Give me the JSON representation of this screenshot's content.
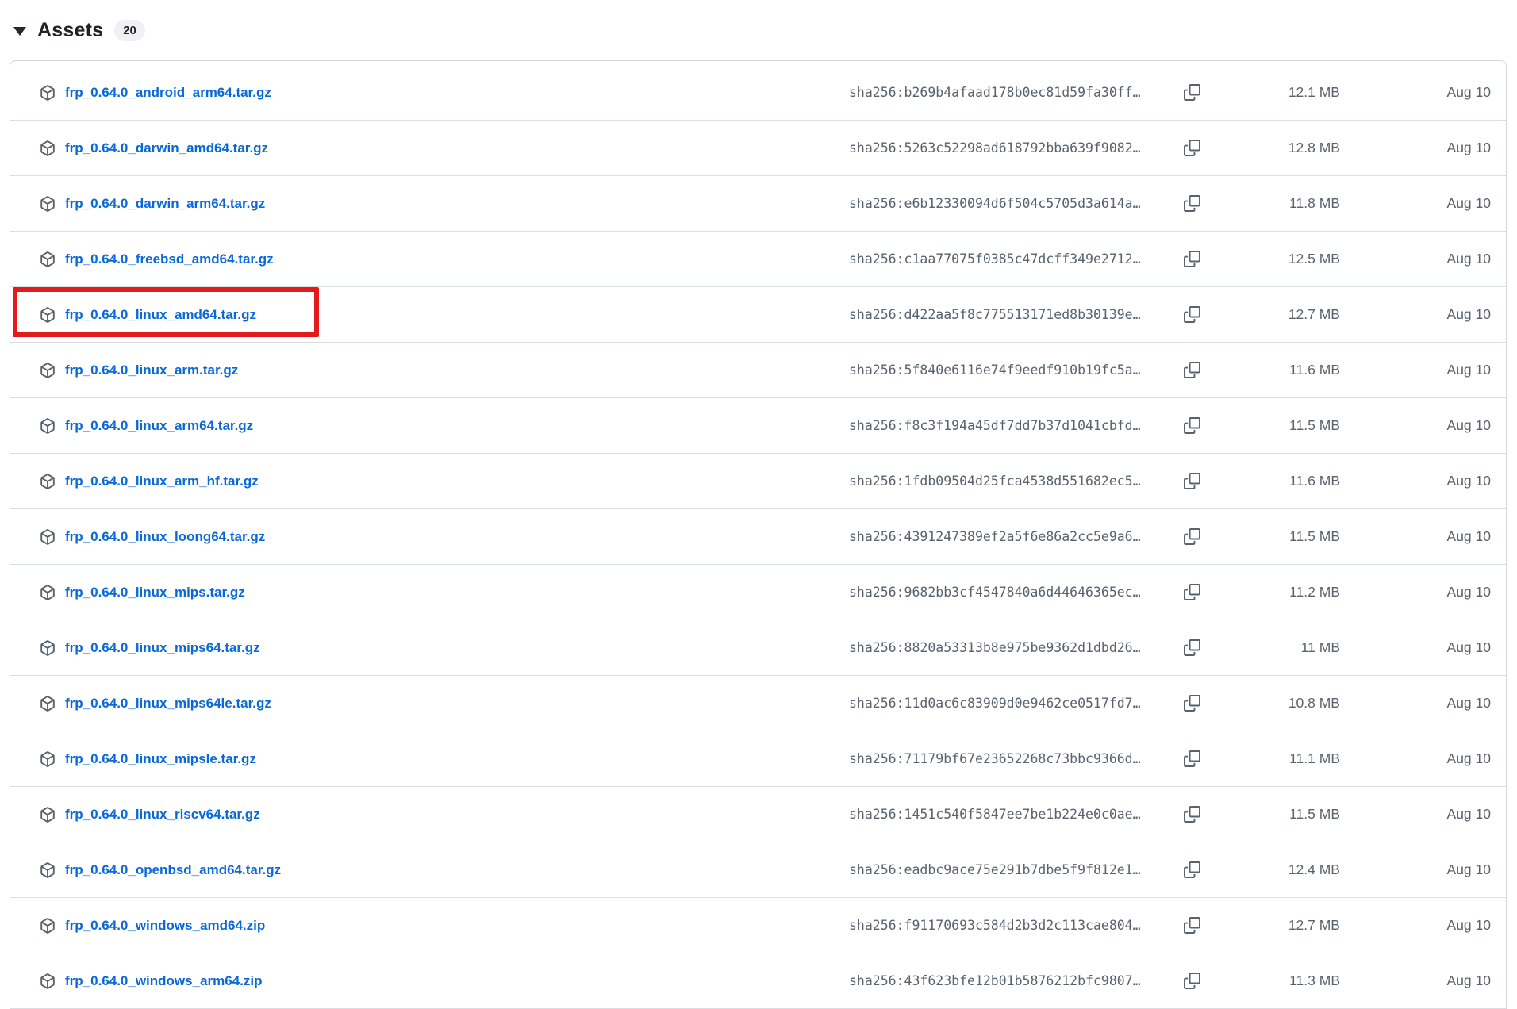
{
  "header": {
    "title": "Assets",
    "count": "20"
  },
  "colors": {
    "link_blue": "#0969da",
    "muted_gray": "#59636e",
    "row_border": "#d9dee3",
    "table_border": "#d0d7de",
    "badge_bg": "#eff1f4",
    "highlight_red": "#e31b1b"
  },
  "table": {
    "rows": [
      {
        "file": "frp_0.64.0_android_arm64.tar.gz",
        "hash": "sha256:b269b4afaad178b0ec81d59fa30ff…",
        "size": "12.1 MB",
        "date": "Aug 10",
        "highlighted": false
      },
      {
        "file": "frp_0.64.0_darwin_amd64.tar.gz",
        "hash": "sha256:5263c52298ad618792bba639f9082…",
        "size": "12.8 MB",
        "date": "Aug 10",
        "highlighted": false
      },
      {
        "file": "frp_0.64.0_darwin_arm64.tar.gz",
        "hash": "sha256:e6b12330094d6f504c5705d3a614a…",
        "size": "11.8 MB",
        "date": "Aug 10",
        "highlighted": false
      },
      {
        "file": "frp_0.64.0_freebsd_amd64.tar.gz",
        "hash": "sha256:c1aa77075f0385c47dcff349e2712…",
        "size": "12.5 MB",
        "date": "Aug 10",
        "highlighted": false
      },
      {
        "file": "frp_0.64.0_linux_amd64.tar.gz",
        "hash": "sha256:d422aa5f8c775513171ed8b30139e…",
        "size": "12.7 MB",
        "date": "Aug 10",
        "highlighted": true
      },
      {
        "file": "frp_0.64.0_linux_arm.tar.gz",
        "hash": "sha256:5f840e6116e74f9eedf910b19fc5a…",
        "size": "11.6 MB",
        "date": "Aug 10",
        "highlighted": false
      },
      {
        "file": "frp_0.64.0_linux_arm64.tar.gz",
        "hash": "sha256:f8c3f194a45df7dd7b37d1041cbfd…",
        "size": "11.5 MB",
        "date": "Aug 10",
        "highlighted": false
      },
      {
        "file": "frp_0.64.0_linux_arm_hf.tar.gz",
        "hash": "sha256:1fdb09504d25fca4538d551682ec5…",
        "size": "11.6 MB",
        "date": "Aug 10",
        "highlighted": false
      },
      {
        "file": "frp_0.64.0_linux_loong64.tar.gz",
        "hash": "sha256:4391247389ef2a5f6e86a2cc5e9a6…",
        "size": "11.5 MB",
        "date": "Aug 10",
        "highlighted": false
      },
      {
        "file": "frp_0.64.0_linux_mips.tar.gz",
        "hash": "sha256:9682bb3cf4547840a6d44646365ec…",
        "size": "11.2 MB",
        "date": "Aug 10",
        "highlighted": false
      },
      {
        "file": "frp_0.64.0_linux_mips64.tar.gz",
        "hash": "sha256:8820a53313b8e975be9362d1dbd26…",
        "size": "11 MB",
        "date": "Aug 10",
        "highlighted": false
      },
      {
        "file": "frp_0.64.0_linux_mips64le.tar.gz",
        "hash": "sha256:11d0ac6c83909d0e9462ce0517fd7…",
        "size": "10.8 MB",
        "date": "Aug 10",
        "highlighted": false
      },
      {
        "file": "frp_0.64.0_linux_mipsle.tar.gz",
        "hash": "sha256:71179bf67e23652268c73bbc9366d…",
        "size": "11.1 MB",
        "date": "Aug 10",
        "highlighted": false
      },
      {
        "file": "frp_0.64.0_linux_riscv64.tar.gz",
        "hash": "sha256:1451c540f5847ee7be1b224e0c0ae…",
        "size": "11.5 MB",
        "date": "Aug 10",
        "highlighted": false
      },
      {
        "file": "frp_0.64.0_openbsd_amd64.tar.gz",
        "hash": "sha256:eadbc9ace75e291b7dbe5f9f812e1…",
        "size": "12.4 MB",
        "date": "Aug 10",
        "highlighted": false
      },
      {
        "file": "frp_0.64.0_windows_amd64.zip",
        "hash": "sha256:f91170693c584d2b3d2c113cae804…",
        "size": "12.7 MB",
        "date": "Aug 10",
        "highlighted": false
      },
      {
        "file": "frp_0.64.0_windows_arm64.zip",
        "hash": "sha256:43f623bfe12b01b5876212bfc9807…",
        "size": "11.3 MB",
        "date": "Aug 10",
        "highlighted": false
      }
    ]
  }
}
